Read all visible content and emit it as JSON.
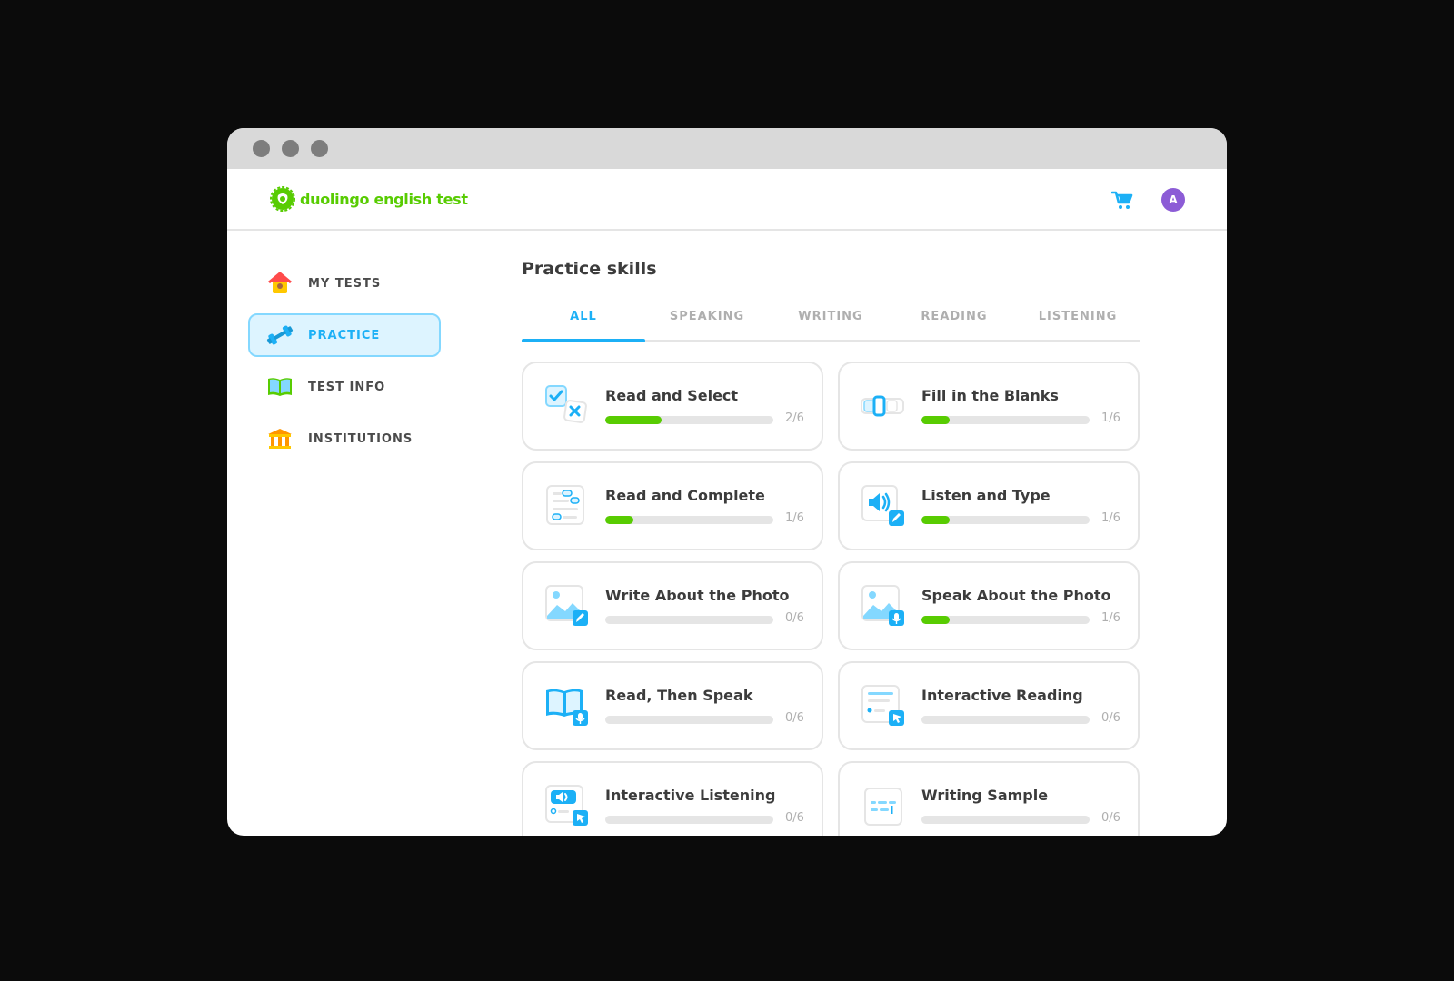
{
  "window": {
    "controls": [
      "close",
      "minimize",
      "maximize"
    ]
  },
  "header": {
    "logo_text": "duolingo english test",
    "cart_icon": "cart-icon",
    "avatar_initial": "A",
    "colors": {
      "brand": "#58cc02",
      "accent": "#1cb0f6",
      "avatar": "#8c5cd6"
    }
  },
  "sidebar": {
    "items": [
      {
        "label": "MY TESTS",
        "icon": "house-icon",
        "active": false
      },
      {
        "label": "PRACTICE",
        "icon": "dumbbell-icon",
        "active": true
      },
      {
        "label": "TEST INFO",
        "icon": "book-icon",
        "active": false
      },
      {
        "label": "INSTITUTIONS",
        "icon": "institution-icon",
        "active": false
      }
    ]
  },
  "main": {
    "title": "Practice skills",
    "tabs": [
      {
        "label": "ALL",
        "active": true
      },
      {
        "label": "SPEAKING",
        "active": false
      },
      {
        "label": "WRITING",
        "active": false
      },
      {
        "label": "READING",
        "active": false
      },
      {
        "label": "LISTENING",
        "active": false
      }
    ],
    "skills": [
      {
        "title": "Read and Select",
        "count": "2/6",
        "progress": 0.3333,
        "icon": "read-select-icon"
      },
      {
        "title": "Fill in the Blanks",
        "count": "1/6",
        "progress": 0.1667,
        "icon": "fill-blanks-icon"
      },
      {
        "title": "Read and Complete",
        "count": "1/6",
        "progress": 0.1667,
        "icon": "read-complete-icon"
      },
      {
        "title": "Listen and Type",
        "count": "1/6",
        "progress": 0.1667,
        "icon": "listen-type-icon"
      },
      {
        "title": "Write About the Photo",
        "count": "0/6",
        "progress": 0,
        "icon": "write-photo-icon"
      },
      {
        "title": "Speak About the Photo",
        "count": "1/6",
        "progress": 0.1667,
        "icon": "speak-photo-icon"
      },
      {
        "title": "Read, Then Speak",
        "count": "0/6",
        "progress": 0,
        "icon": "read-speak-icon"
      },
      {
        "title": "Interactive Reading",
        "count": "0/6",
        "progress": 0,
        "icon": "interactive-reading-icon"
      },
      {
        "title": "Interactive Listening",
        "count": "0/6",
        "progress": 0,
        "icon": "interactive-listening-icon"
      },
      {
        "title": "Writing Sample",
        "count": "0/6",
        "progress": 0,
        "icon": "writing-sample-icon"
      }
    ]
  }
}
